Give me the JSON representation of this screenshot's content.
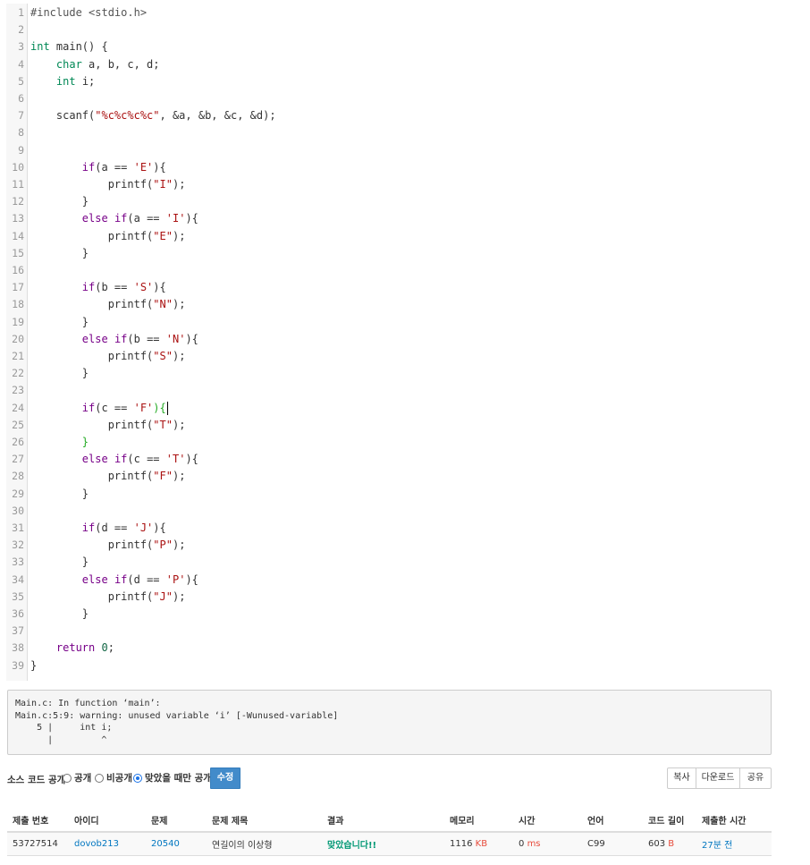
{
  "code_lines": [
    [
      {
        "t": "#include <stdio.h>",
        "c": "tok-meta"
      }
    ],
    [],
    [
      {
        "t": "int",
        "c": "tok-type"
      },
      {
        "t": " main() {"
      }
    ],
    [
      {
        "t": "    "
      },
      {
        "t": "char",
        "c": "tok-type"
      },
      {
        "t": " a, b, c, d;"
      }
    ],
    [
      {
        "t": "    "
      },
      {
        "t": "int",
        "c": "tok-type"
      },
      {
        "t": " i;"
      }
    ],
    [],
    [
      {
        "t": "    scanf("
      },
      {
        "t": "\"%c%c%c%c\"",
        "c": "tok-str"
      },
      {
        "t": ", &a, &b, &c, &d);"
      }
    ],
    [],
    [],
    [
      {
        "t": "        "
      },
      {
        "t": "if",
        "c": "tok-kw"
      },
      {
        "t": "(a == "
      },
      {
        "t": "'E'",
        "c": "tok-str"
      },
      {
        "t": "){"
      }
    ],
    [
      {
        "t": "            printf("
      },
      {
        "t": "\"I\"",
        "c": "tok-str"
      },
      {
        "t": ");"
      }
    ],
    [
      {
        "t": "        }"
      }
    ],
    [
      {
        "t": "        "
      },
      {
        "t": "else",
        "c": "tok-kw"
      },
      {
        "t": " "
      },
      {
        "t": "if",
        "c": "tok-kw"
      },
      {
        "t": "(a == "
      },
      {
        "t": "'I'",
        "c": "tok-str"
      },
      {
        "t": "){"
      }
    ],
    [
      {
        "t": "            printf("
      },
      {
        "t": "\"E\"",
        "c": "tok-str"
      },
      {
        "t": ");"
      }
    ],
    [
      {
        "t": "        }"
      }
    ],
    [],
    [
      {
        "t": "        "
      },
      {
        "t": "if",
        "c": "tok-kw"
      },
      {
        "t": "(b == "
      },
      {
        "t": "'S'",
        "c": "tok-str"
      },
      {
        "t": "){"
      }
    ],
    [
      {
        "t": "            printf("
      },
      {
        "t": "\"N\"",
        "c": "tok-str"
      },
      {
        "t": ");"
      }
    ],
    [
      {
        "t": "        }"
      }
    ],
    [
      {
        "t": "        "
      },
      {
        "t": "else",
        "c": "tok-kw"
      },
      {
        "t": " "
      },
      {
        "t": "if",
        "c": "tok-kw"
      },
      {
        "t": "(b == "
      },
      {
        "t": "'N'",
        "c": "tok-str"
      },
      {
        "t": "){"
      }
    ],
    [
      {
        "t": "            printf("
      },
      {
        "t": "\"S\"",
        "c": "tok-str"
      },
      {
        "t": ");"
      }
    ],
    [
      {
        "t": "        }"
      }
    ],
    [],
    [
      {
        "t": "        "
      },
      {
        "t": "if",
        "c": "tok-kw"
      },
      {
        "t": "(c == "
      },
      {
        "t": "'F'",
        "c": "tok-str"
      },
      {
        "t": "){",
        "c": "tok-brace-match"
      },
      {
        "t": "",
        "cursor": true
      }
    ],
    [
      {
        "t": "            printf("
      },
      {
        "t": "\"T\"",
        "c": "tok-str"
      },
      {
        "t": ");"
      }
    ],
    [
      {
        "t": "        "
      },
      {
        "t": "}",
        "c": "tok-brace-match"
      }
    ],
    [
      {
        "t": "        "
      },
      {
        "t": "else",
        "c": "tok-kw"
      },
      {
        "t": " "
      },
      {
        "t": "if",
        "c": "tok-kw"
      },
      {
        "t": "(c == "
      },
      {
        "t": "'T'",
        "c": "tok-str"
      },
      {
        "t": "){"
      }
    ],
    [
      {
        "t": "            printf("
      },
      {
        "t": "\"F\"",
        "c": "tok-str"
      },
      {
        "t": ");"
      }
    ],
    [
      {
        "t": "        }"
      }
    ],
    [],
    [
      {
        "t": "        "
      },
      {
        "t": "if",
        "c": "tok-kw"
      },
      {
        "t": "(d == "
      },
      {
        "t": "'J'",
        "c": "tok-str"
      },
      {
        "t": "){"
      }
    ],
    [
      {
        "t": "            printf("
      },
      {
        "t": "\"P\"",
        "c": "tok-str"
      },
      {
        "t": ");"
      }
    ],
    [
      {
        "t": "        }"
      }
    ],
    [
      {
        "t": "        "
      },
      {
        "t": "else",
        "c": "tok-kw"
      },
      {
        "t": " "
      },
      {
        "t": "if",
        "c": "tok-kw"
      },
      {
        "t": "(d == "
      },
      {
        "t": "'P'",
        "c": "tok-str"
      },
      {
        "t": "){"
      }
    ],
    [
      {
        "t": "            printf("
      },
      {
        "t": "\"J\"",
        "c": "tok-str"
      },
      {
        "t": ");"
      }
    ],
    [
      {
        "t": "        }"
      }
    ],
    [],
    [
      {
        "t": "    "
      },
      {
        "t": "return",
        "c": "tok-kw"
      },
      {
        "t": " "
      },
      {
        "t": "0",
        "c": "tok-num"
      },
      {
        "t": ";"
      }
    ],
    [
      {
        "t": "}"
      }
    ]
  ],
  "compile_output": "Main.c: In function ‘main’:\nMain.c:5:9: warning: unused variable ‘i’ [-Wunused-variable]\n    5 |     int i;\n      |         ^",
  "visibility": {
    "label": "소스 코드 공개",
    "options": [
      {
        "label": "공개",
        "checked": false
      },
      {
        "label": "비공개",
        "checked": false
      },
      {
        "label": "맞았을 때만 공개",
        "checked": true
      }
    ],
    "edit_label": "수정"
  },
  "actions": {
    "copy_label": "복사",
    "download_label": "다운로드",
    "share_label": "공유"
  },
  "table": {
    "headers": [
      "제출 번호",
      "아이디",
      "문제",
      "문제 제목",
      "결과",
      "메모리",
      "시간",
      "언어",
      "코드 길이",
      "제출한 시간"
    ],
    "row": {
      "submission_id": "53727514",
      "user_id": "dovob213",
      "problem_id": "20540",
      "problem_title": "연길이의 이상형",
      "result": "맞았습니다!!",
      "memory": "1116",
      "memory_unit": "KB",
      "time": "0",
      "time_unit": "ms",
      "language": "C99",
      "code_length": "603",
      "code_length_unit": "B",
      "submitted_ago": "27분 전"
    }
  }
}
